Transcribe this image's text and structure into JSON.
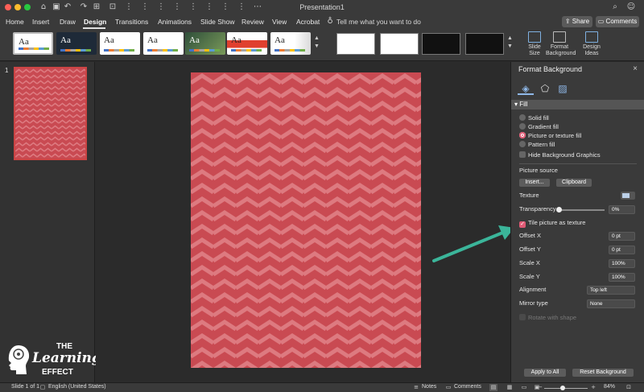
{
  "window": {
    "title": "Presentation1"
  },
  "tabs": [
    "Home",
    "Insert",
    "Draw",
    "Design",
    "Transitions",
    "Animations",
    "Slide Show",
    "Review",
    "View",
    "Acrobat"
  ],
  "active_tab": "Design",
  "tell_me": "Tell me what you want to do",
  "share_label": "Share",
  "comments_label": "Comments",
  "ribbon": {
    "theme_label": "Aa",
    "slide_size_label": "Slide Size",
    "format_background_label": "Format Background",
    "design_ideas_label": "Design Ideas"
  },
  "thumbnail": {
    "number": "1"
  },
  "logo": {
    "line1": "THE",
    "line2": "Learning",
    "line3": "EFFECT"
  },
  "pane": {
    "title": "Format Background",
    "close_glyph": "×",
    "section": "Fill",
    "options": {
      "solid": "Solid fill",
      "gradient": "Gradient fill",
      "picture": "Picture or texture fill",
      "pattern": "Pattern fill"
    },
    "selected_option": "picture",
    "hide_graphics": "Hide Background Graphics",
    "picture_source": "Picture source",
    "insert_btn": "Insert...",
    "clipboard_btn": "Clipboard",
    "texture": "Texture",
    "transparency": "Transparency",
    "transparency_value": "0%",
    "tile_label": "Tile picture as texture",
    "tile_checked": true,
    "offset_x": "Offset X",
    "offset_x_value": "0 pt",
    "offset_y": "Offset Y",
    "offset_y_value": "0 pt",
    "scale_x": "Scale X",
    "scale_x_value": "100%",
    "scale_y": "Scale Y",
    "scale_y_value": "100%",
    "alignment": "Alignment",
    "alignment_value": "Top left",
    "mirror": "Mirror type",
    "mirror_value": "None",
    "rotate": "Rotate with shape",
    "apply_all": "Apply to All",
    "reset": "Reset Background"
  },
  "status": {
    "slide": "Slide 1 of 1",
    "language": "English (United States)",
    "notes": "Notes",
    "comments": "Comments",
    "zoom": "84%"
  },
  "colors": {
    "slide_bg": "#c94a52",
    "chevron": "#dd7a80",
    "accent_check": "#e05a75",
    "arrow": "#3bb59a"
  }
}
